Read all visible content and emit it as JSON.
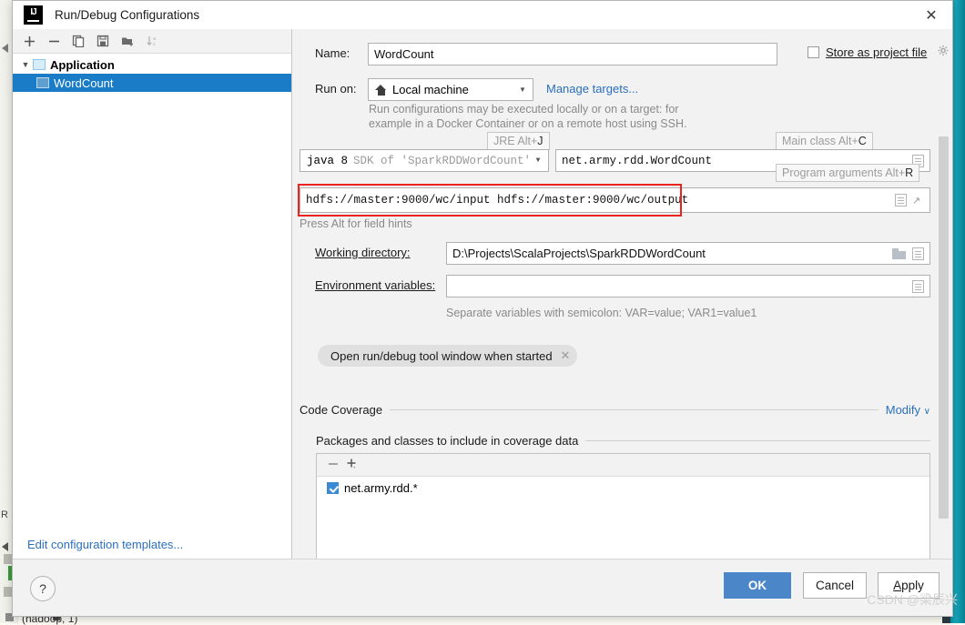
{
  "window": {
    "title": "Run/Debug Configurations",
    "logo_label": "IJ",
    "close_label": "✕"
  },
  "sidebar": {
    "toolbar": [
      {
        "name": "add-button",
        "glyph": "＋"
      },
      {
        "name": "remove-button",
        "glyph": "−"
      },
      {
        "name": "copy-button",
        "glyph": "❐"
      },
      {
        "name": "save-button",
        "glyph": "Ὃe"
      },
      {
        "name": "new-folder-button",
        "glyph": "▰"
      },
      {
        "name": "sort-alphabetically-button",
        "glyph": "↓"
      }
    ],
    "tree": {
      "group_label": "Application",
      "selected_item": "WordCount"
    },
    "edit_templates_link": "Edit configuration templates..."
  },
  "form": {
    "name_label": "Name:",
    "name_value": "WordCount",
    "store_as_project_file_label": "Store as project file",
    "store_as_project_file_checked": false,
    "run_on_label": "Run on:",
    "run_on_value": "Local machine",
    "manage_targets_link": "Manage targets...",
    "run_on_hint_line1": "Run configurations may be executed locally or on a target: for",
    "run_on_hint_line2": "example in a Docker Container or on a remote host using SSH.",
    "jre_badge": "JRE Alt+",
    "jre_badge_key": "J",
    "main_class_badge": "Main class Alt+",
    "main_class_badge_key": "C",
    "program_args_badge": "Program arguments Alt+",
    "program_args_badge_key": "R",
    "jre_value_prefix": "java 8",
    "jre_value_suffix": "SDK of 'SparkRDDWordCount'",
    "main_class_value": "net.army.rdd.WordCount",
    "program_arguments_value": "hdfs://master:9000/wc/input hdfs://master:9000/wc/output",
    "field_hints_text": "Press Alt for field hints",
    "working_directory_label": "Working directory:",
    "working_directory_value": "D:\\Projects\\ScalaProjects\\SparkRDDWordCount",
    "environment_variables_label": "Environment variables:",
    "environment_variables_value": "",
    "environment_variables_hint": "Separate variables with semicolon: VAR=value; VAR1=value1",
    "tool_window_chip_label": "Open run/debug tool window when started",
    "tool_window_chip_close": "✕"
  },
  "coverage": {
    "section_title": "Code Coverage",
    "modify_label": "Modify",
    "modify_chevron": "∨",
    "subsection_title": "Packages and classes to include in coverage data",
    "toolbar": [
      {
        "name": "remove-package-button",
        "glyph": "−"
      },
      {
        "name": "add-package-button",
        "glyph": "＋"
      }
    ],
    "items": [
      {
        "label": "net.army.rdd.*",
        "checked": true
      }
    ]
  },
  "footer": {
    "help_label": "?",
    "ok_label": "OK",
    "cancel_label": "Cancel",
    "apply_label": "Apply",
    "apply_underline": "A",
    "apply_rest": "pply"
  },
  "watermark": "CSDN @梁辰兴",
  "background": {
    "editor_bottom_text": "(hadoop, 1)",
    "accent_teal": "#16a7bc"
  },
  "colors": {
    "selection_blue": "#1a7cc7",
    "primary_button": "#4a86c8",
    "link_blue": "#2b6fbd",
    "highlight_red": "#e8251f",
    "checkbox_blue": "#3d8ad4"
  }
}
